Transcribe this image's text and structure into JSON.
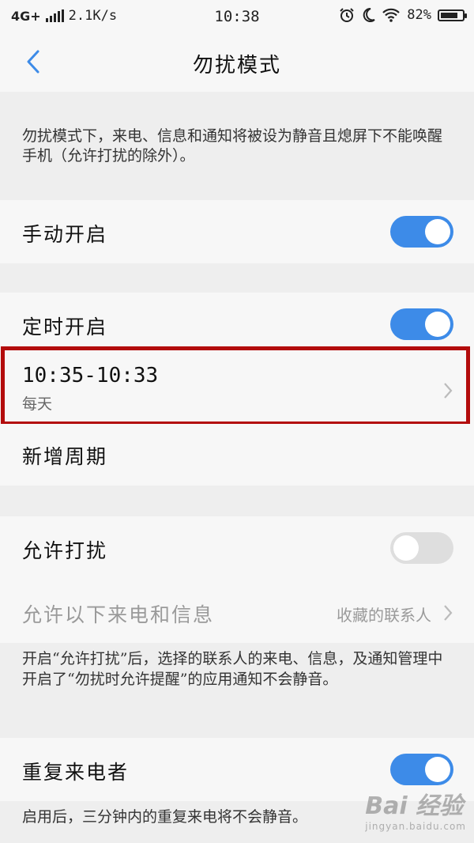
{
  "status_bar": {
    "network": "4G+",
    "speed": "2.1K/s",
    "time": "10:38",
    "battery": "82%",
    "battery_level": 0.82,
    "icons": [
      "signal-icon",
      "alarm-icon",
      "moon-icon",
      "wifi-icon",
      "battery-icon"
    ]
  },
  "header": {
    "title": "勿扰模式",
    "back_icon": "back-arrow-icon"
  },
  "intro_text": "勿扰模式下，来电、信息和通知将被设为静音且熄屏下不能唤醒手机（允许打扰的除外）。",
  "manual": {
    "label": "手动开启",
    "enabled": true
  },
  "scheduled": {
    "label": "定时开启",
    "enabled": true,
    "period": {
      "time": "10:35-10:33",
      "repeat": "每天"
    },
    "add_period": "新增周期"
  },
  "allow": {
    "label": "允许打扰",
    "enabled": false,
    "calls_label": "允许以下来电和信息",
    "calls_value": "收藏的联系人",
    "note": "开启“允许打扰”后，选择的联系人的来电、信息，及通知管理中开启了“勿扰时允许提醒”的应用通知不会静音。"
  },
  "repeat_callers": {
    "label": "重复来电者",
    "enabled": true,
    "note": "启用后，三分钟内的重复来电将不会静音。"
  },
  "watermark": {
    "main": "Bai 经验",
    "sub": "jingyan.baidu.com"
  },
  "colors": {
    "accent": "#3d8be8",
    "highlight": "#b30c0c",
    "disabled": "#9a9a9a"
  }
}
